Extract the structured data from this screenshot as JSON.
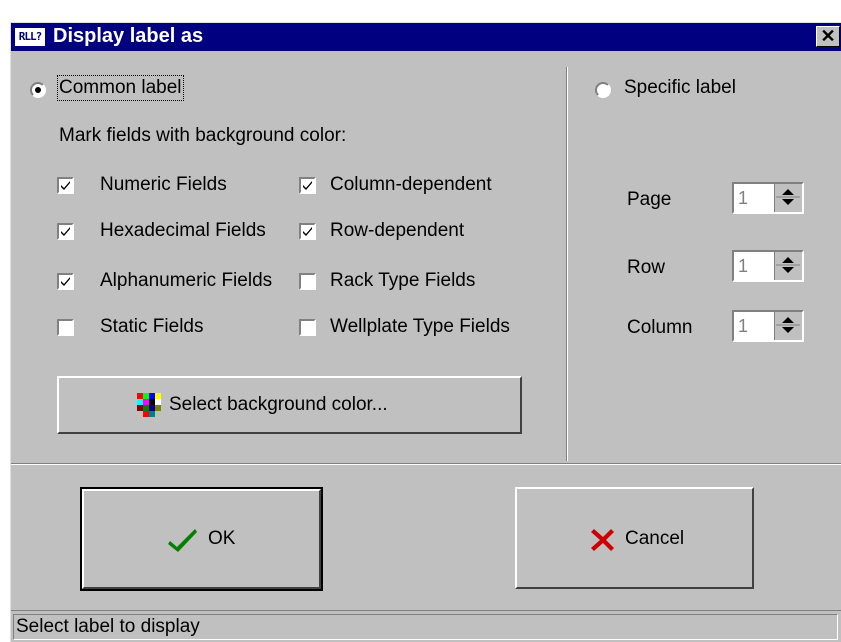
{
  "window": {
    "title": "Display label as",
    "icon_label": "RLL?",
    "close_label": "✕"
  },
  "common": {
    "radio_label": "Common label",
    "selected": true,
    "mark_heading": "Mark fields with background color:",
    "checkboxes": [
      {
        "label": "Numeric Fields",
        "checked": true
      },
      {
        "label": "Hexadecimal Fields",
        "checked": true
      },
      {
        "label": "Alphanumeric Fields",
        "checked": true
      },
      {
        "label": "Static Fields",
        "checked": false
      },
      {
        "label": "Column-dependent",
        "checked": true
      },
      {
        "label": "Row-dependent",
        "checked": true
      },
      {
        "label": "Rack Type Fields",
        "checked": false
      },
      {
        "label": "Wellplate Type Fields",
        "checked": false
      }
    ],
    "select_color_button": "Select background color..."
  },
  "specific": {
    "radio_label": "Specific label",
    "selected": false,
    "page_label": "Page",
    "page_value": "1",
    "row_label": "Row",
    "row_value": "1",
    "column_label": "Column",
    "column_value": "1"
  },
  "buttons": {
    "ok_label": "OK",
    "cancel_label": "Cancel"
  },
  "status": {
    "text": "Select label to display"
  },
  "colors": {
    "title_bar": "#000080",
    "face": "#c0c0c0",
    "ok_check": "#008000",
    "cancel_x": "#cc0000"
  }
}
